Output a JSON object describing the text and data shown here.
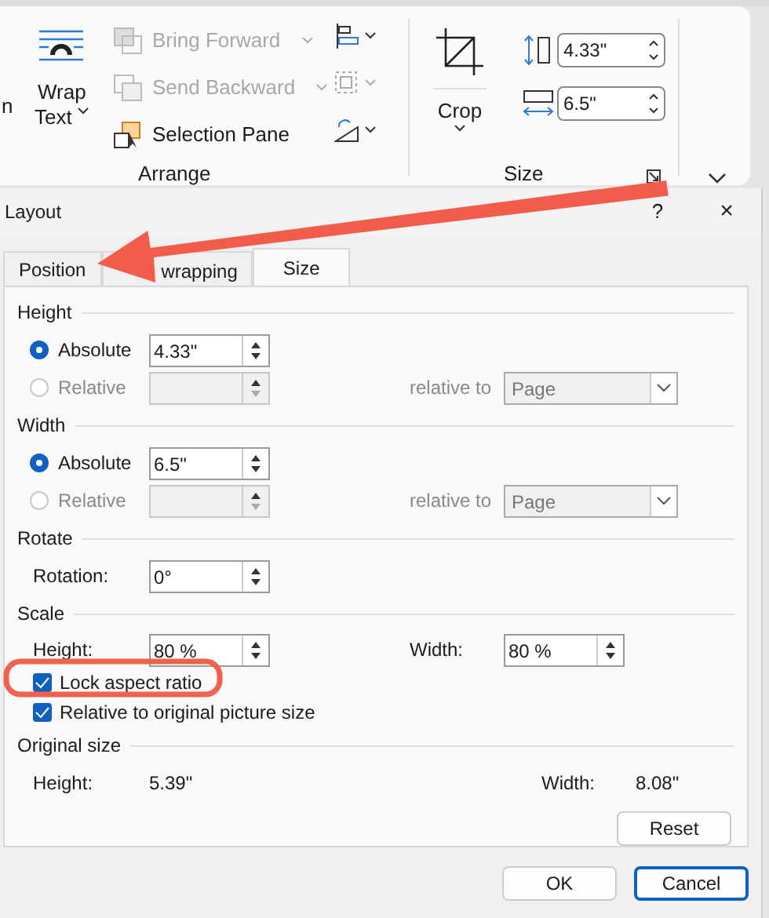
{
  "ribbon": {
    "cut_label": "n",
    "wrap_text": [
      "Wrap",
      "Text"
    ],
    "arrange_items": [
      {
        "kind": "bring_forward",
        "label": "Bring Forward",
        "disabled": true
      },
      {
        "kind": "send_backward",
        "label": "Send Backward",
        "disabled": true
      },
      {
        "kind": "selection_pane",
        "label": "Selection Pane",
        "disabled": false
      }
    ],
    "arrange_label": "Arrange",
    "crop_label": "Crop",
    "height_value": "4.33\"",
    "width_value": "6.5\"",
    "size_label": "Size"
  },
  "dialog": {
    "title": "Layout",
    "help": "?",
    "close": "×",
    "tabs": [
      {
        "label": "Position",
        "selected": false
      },
      {
        "label": "wrapping",
        "selected": false
      },
      {
        "label": "Size",
        "selected": true
      }
    ],
    "sections": [
      {
        "title": "Height",
        "rows": [
          {
            "kind": "radio",
            "label": "Absolute",
            "selected": true,
            "disabled": false,
            "value": "4.33\""
          },
          {
            "kind": "radio",
            "label": "Relative",
            "selected": false,
            "disabled": true,
            "relative_to": "relative to",
            "dropdown": "Page"
          }
        ]
      },
      {
        "title": "Width",
        "rows": [
          {
            "kind": "radio",
            "label": "Absolute",
            "selected": true,
            "disabled": false,
            "value": "6.5\""
          },
          {
            "kind": "radio",
            "label": "Relative",
            "selected": false,
            "disabled": true,
            "relative_to": "relative to",
            "dropdown": "Page"
          }
        ]
      },
      {
        "title": "Rotate",
        "rows": [
          {
            "kind": "spin",
            "label": "Rotation:",
            "value": "0°"
          }
        ]
      },
      {
        "title": "Scale",
        "rows": [
          {
            "kind": "spin",
            "label": "Height:",
            "value": "80 %",
            "label2": "Width:",
            "value2": "80 %"
          },
          {
            "kind": "checkbox",
            "label": "Lock aspect ratio",
            "checked": true
          },
          {
            "kind": "checkbox",
            "label": "Relative to original picture size",
            "checked": true
          }
        ]
      },
      {
        "title": "Original size",
        "rows": [
          {
            "kind": "info",
            "label": "Height:",
            "value": "5.39\"",
            "label2": "Width:",
            "value2": "8.08\""
          }
        ]
      }
    ],
    "reset": "Reset",
    "ok": "OK",
    "cancel": "Cancel"
  }
}
